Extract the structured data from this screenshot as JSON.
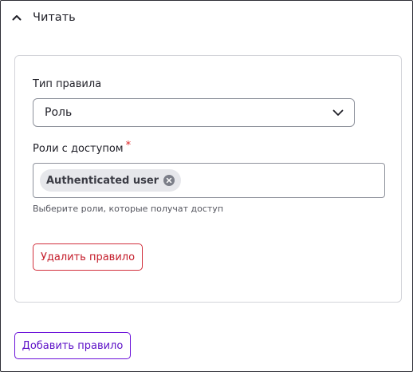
{
  "section": {
    "title": "Читать",
    "expanded": true
  },
  "rule": {
    "type_label": "Тип правила",
    "type_value": "Роль",
    "roles_label": "Роли с доступом",
    "required_marker": "*",
    "roles": [
      {
        "label": "Authenticated user"
      }
    ],
    "roles_hint": "Выберите роли, которые получат доступ",
    "delete_label": "Удалить правило"
  },
  "actions": {
    "add_rule_label": "Добавить правило"
  },
  "colors": {
    "danger": "#c41c2a",
    "primary": "#5c0fc7",
    "required": "#dc2323"
  }
}
